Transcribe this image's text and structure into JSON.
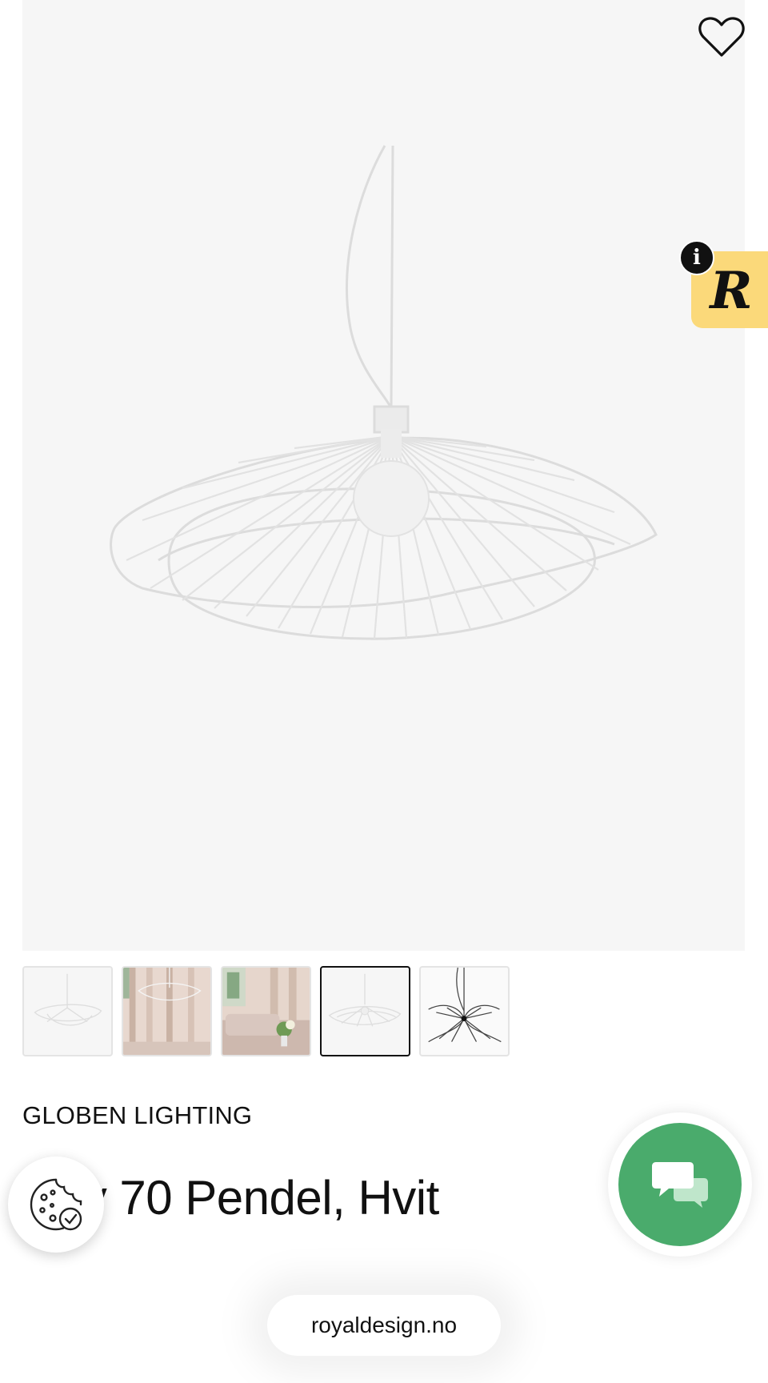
{
  "product": {
    "brand": "GLOBEN LIGHTING",
    "title": "Ray 70 Pendel, Hvit",
    "title_visible": "y 70 Pendel, Hvit"
  },
  "hero": {
    "image": "white-wire-pendant-lamp",
    "favorite_icon": "heart-outline-icon"
  },
  "review_badge": {
    "letter": "R",
    "info_label": "i",
    "color": "#fbd97a"
  },
  "thumbnails": [
    {
      "name": "lamp-front-white",
      "active": false
    },
    {
      "name": "lamp-room-interior-1",
      "active": false
    },
    {
      "name": "lamp-room-interior-2",
      "active": false
    },
    {
      "name": "lamp-side-white",
      "active": true
    },
    {
      "name": "lamp-black-variant",
      "active": false
    }
  ],
  "floating": {
    "cookie_icon": "cookie-icon",
    "chat_icon": "chat-bubbles-icon",
    "chat_color": "#4aab6c"
  },
  "browser": {
    "url": "royaldesign.no"
  }
}
